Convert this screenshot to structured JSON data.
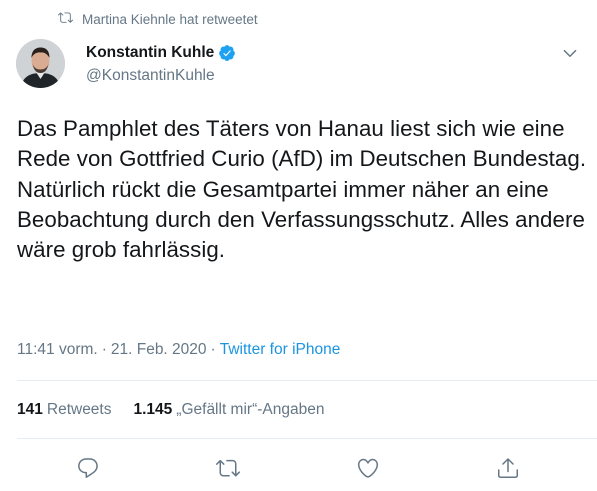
{
  "retweet": {
    "label": "Martina Kiehnle hat retweetet"
  },
  "author": {
    "display_name": "Konstantin Kuhle",
    "handle": "@KonstantinKuhle"
  },
  "tweet": {
    "text": "Das Pamphlet des Täters von Hanau liest sich wie eine Rede von Gottfried Curio (AfD) im Deutschen Bundestag. Natürlich rückt die Gesamtpartei immer näher an eine Beobachtung durch den Verfassungsschutz. Alles andere wäre grob fahrlässig.",
    "time": "11:41 vorm.",
    "separator": "·",
    "date": "21. Feb. 2020",
    "source": "Twitter for iPhone"
  },
  "stats": {
    "retweets_count": "141",
    "retweets_label": "Retweets",
    "likes_count": "1.145",
    "likes_label": "„Gefällt mir“-Angaben"
  },
  "icons": {
    "retweet": "retweet-icon",
    "verified": "verified-badge-icon",
    "caret": "chevron-down-icon",
    "reply": "reply-icon",
    "like": "heart-icon",
    "share": "share-icon"
  },
  "colors": {
    "accent": "#1da1f2",
    "link": "#1b95e0",
    "secondary": "#657786",
    "divider": "#e6ecf0"
  }
}
